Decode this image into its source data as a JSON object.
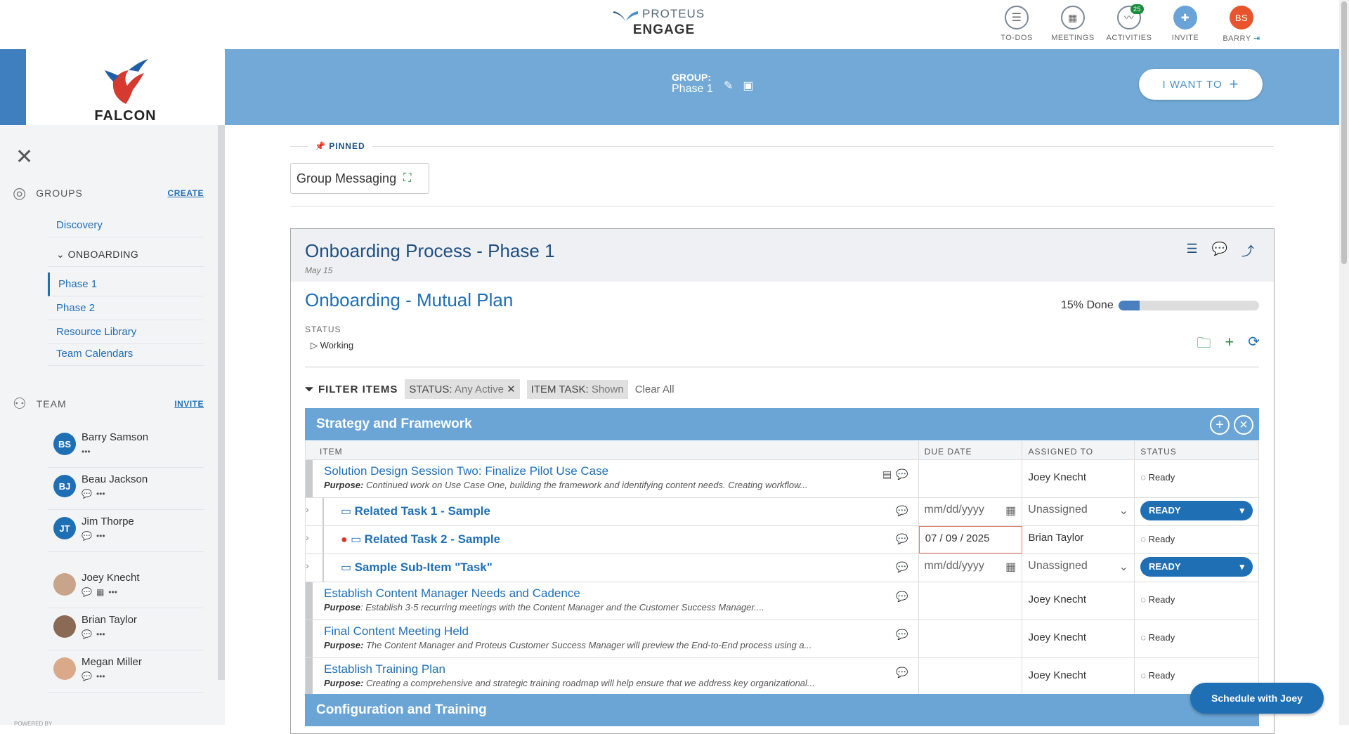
{
  "app": {
    "brand_line1": "PROTEUS",
    "brand_line2": "ENGAGE"
  },
  "top_nav": [
    {
      "label": "TO-DOS",
      "icon": "list-icon"
    },
    {
      "label": "MEETINGS",
      "icon": "calendar-icon"
    },
    {
      "label": "ACTIVITIES",
      "icon": "activity-icon",
      "badge": "25"
    },
    {
      "label": "INVITE",
      "icon": "add-user-icon"
    },
    {
      "label": "BARRY",
      "initials": "BS",
      "icon": "logout-icon"
    }
  ],
  "logo": {
    "text": "FALCON"
  },
  "group": {
    "label": "GROUP:",
    "name": "Phase 1"
  },
  "i_want_to": "I WANT TO",
  "sidebar": {
    "groups_label": "GROUPS",
    "create_link": "CREATE",
    "items": [
      {
        "label": "Discovery"
      },
      {
        "label": "ONBOARDING",
        "type": "folder"
      },
      {
        "label": "Phase 1",
        "active": true
      },
      {
        "label": "Phase 2"
      },
      {
        "label": "Resource Library"
      },
      {
        "label": "Team Calendars"
      }
    ],
    "team_label": "TEAM",
    "invite_link": "INVITE",
    "members": [
      {
        "initials": "BS",
        "name": "Barry Samson",
        "icons": "•••"
      },
      {
        "initials": "BJ",
        "name": "Beau Jackson",
        "icons": "•••"
      },
      {
        "initials": "JT",
        "name": "Jim Thorpe",
        "icons": "•••"
      },
      {
        "initials": "",
        "name": "Joey Knecht",
        "icons": "•••"
      },
      {
        "initials": "",
        "name": "Brian Taylor",
        "icons": "•••"
      },
      {
        "initials": "",
        "name": "Megan Miller",
        "icons": "•••"
      }
    ]
  },
  "pinned": {
    "label": "PINNED",
    "card": "Group Messaging"
  },
  "card": {
    "title": "Onboarding Process - Phase 1",
    "date": "May 15",
    "plan_title": "Onboarding - Mutual Plan",
    "progress_label": "15% Done",
    "progress": 0.15,
    "status_label": "STATUS",
    "status_value": "Working"
  },
  "filters": {
    "label": "FILTER ITEMS",
    "chips": [
      {
        "key": "STATUS:",
        "value": "Any Active"
      },
      {
        "key": "ITEM TASK:",
        "value": "Shown"
      }
    ],
    "clear_all": "Clear All"
  },
  "sections": [
    {
      "title": "Strategy and Framework"
    },
    {
      "title": "Configuration and Training"
    }
  ],
  "table": {
    "columns": [
      "ITEM",
      "DUE DATE",
      "ASSIGNED TO",
      "STATUS"
    ],
    "rows": [
      {
        "title": "Solution Design Session Two: Finalize Pilot Use Case",
        "purpose_label": "Purpose:",
        "purpose": "Continued work on Use Case One, building the framework and identifying content needs. Creating workflow...",
        "due": "",
        "assigned": "Joey Knecht",
        "status": "Ready",
        "kind": "item"
      },
      {
        "title": "Related Task 1 - Sample",
        "due": "mm/dd/yyyy",
        "assigned": "Unassigned",
        "status": "READY",
        "kind": "task-edit"
      },
      {
        "title": "Related Task 2 - Sample",
        "due": "07 / 09 / 2025",
        "assigned": "Brian Taylor",
        "status": "Ready",
        "kind": "task"
      },
      {
        "title": "Sample Sub-Item \"Task\"",
        "due": "mm/dd/yyyy",
        "assigned": "Unassigned",
        "status": "READY",
        "kind": "task-edit"
      },
      {
        "title": "Establish Content Manager Needs and Cadence",
        "purpose_label": "Purpose",
        "purpose": ": Establish 3-5 recurring meetings with the Content Manager and the Customer Success Manager....",
        "due": "",
        "assigned": "Joey Knecht",
        "status": "Ready",
        "kind": "item"
      },
      {
        "title": "Final Content Meeting Held",
        "purpose_label": "Purpose:",
        "purpose": "The Content Manager and Proteus Customer Success Manager will preview the End-to-End process using a...",
        "due": "",
        "assigned": "Joey Knecht",
        "status": "Ready",
        "kind": "item"
      },
      {
        "title": "Establish Training Plan",
        "purpose_label": "Purpose:",
        "purpose": "Creating a comprehensive and strategic training roadmap will help ensure that we address key organizational...",
        "due": "",
        "assigned": "Joey Knecht",
        "status": "Ready",
        "kind": "item"
      }
    ]
  },
  "schedule_button": "Schedule with Joey",
  "powered_by": "POWERED BY"
}
